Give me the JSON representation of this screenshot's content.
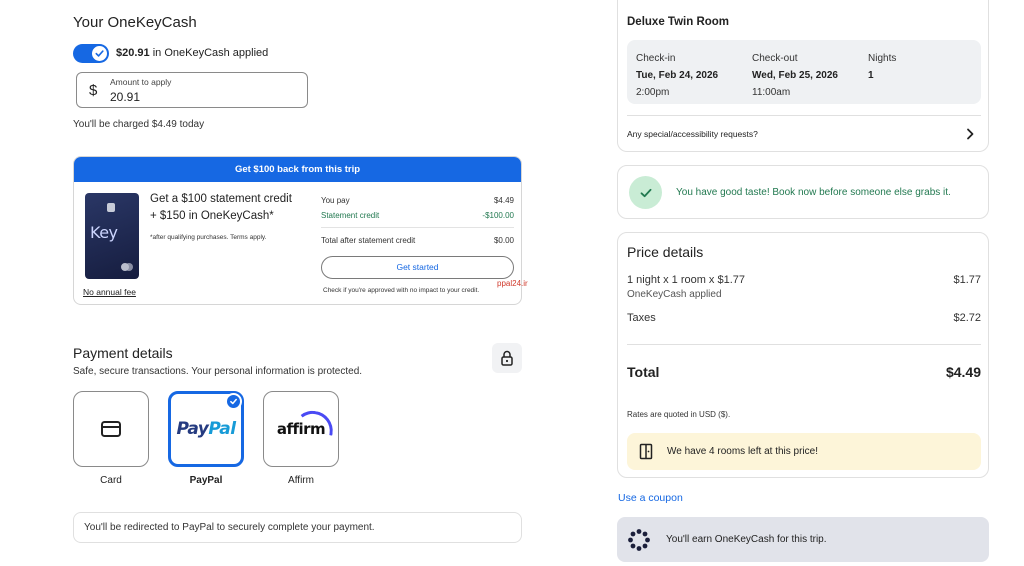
{
  "onekeycash": {
    "title": "Your OneKeyCash",
    "toggle_amount": "$20.91",
    "toggle_suffix": " in OneKeyCash applied",
    "amount_label": "Amount to apply",
    "amount_currency": "$",
    "amount_value": "20.91",
    "charged_text": "You'll be charged $4.49 today"
  },
  "promo": {
    "header": "Get $100 back from this trip",
    "card_brand": "Key",
    "headline1": "Get a $100 statement credit",
    "headline2": "+ $150 in OneKeyCash*",
    "fine_print": "*after qualifying purchases. Terms apply.",
    "no_annual_fee": "No annual fee",
    "you_pay_label": "You pay",
    "you_pay_value": "$4.49",
    "credit_label": "Statement credit",
    "credit_value": "-$100.00",
    "after_label": "Total after statement credit",
    "after_value": "$0.00",
    "cta": "Get started",
    "check_text": "Check if you're approved with no impact to your credit."
  },
  "watermark": "ppal24.ir",
  "payment": {
    "title": "Payment details",
    "subtitle": "Safe, secure transactions. Your personal information is protected.",
    "methods": [
      {
        "label": "Card",
        "icon": "credit-card-icon",
        "selected": false
      },
      {
        "label": "PayPal",
        "logo_a": "Pay",
        "logo_b": "Pal",
        "selected": true
      },
      {
        "label": "Affirm",
        "logo": "affirm",
        "selected": false
      }
    ],
    "redirect_text": "You'll be redirected to PayPal to securely complete your payment."
  },
  "room": {
    "name": "Deluxe Twin Room",
    "checkin_label": "Check-in",
    "checkin_date": "Tue, Feb 24, 2026",
    "checkin_time": "2:00pm",
    "checkout_label": "Check-out",
    "checkout_date": "Wed, Feb 25, 2026",
    "checkout_time": "11:00am",
    "nights_label": "Nights",
    "nights_value": "1",
    "requests": "Any special/accessibility requests?"
  },
  "taste_message": "You have good taste! Book now before someone else grabs it.",
  "price": {
    "title": "Price details",
    "line1_label": "1 night x 1 room x $1.77",
    "line1_value": "$1.77",
    "line1_sub": "OneKeyCash applied",
    "taxes_label": "Taxes",
    "taxes_value": "$2.72",
    "total_label": "Total",
    "total_value": "$4.49",
    "rates_note": "Rates are quoted in USD ($).",
    "rooms_left": "We have 4 rooms left at this price!"
  },
  "coupon_link": "Use a coupon",
  "earn_text": "You'll earn OneKeyCash for this trip.",
  "colors": {
    "accent": "#1668e3",
    "success": "#227950",
    "warning_bg": "#fdf5d9"
  }
}
